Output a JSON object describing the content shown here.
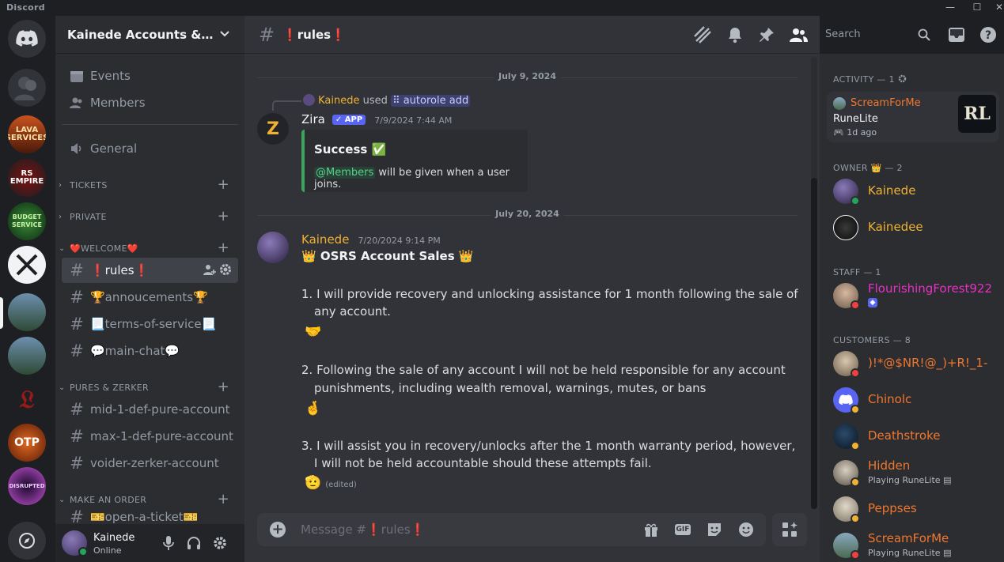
{
  "window": {
    "brand": "Discord",
    "controls": [
      "minimize",
      "maximize",
      "close"
    ]
  },
  "rail": {
    "servers": [
      {
        "label": "LAVA SERVICES",
        "color": "#c8521f"
      },
      {
        "label": "RS EMPIRE",
        "color": "#7a1010"
      },
      {
        "label": "BUDGET SERVICE",
        "color": "#1c5a22"
      },
      {
        "label": "",
        "color": "#f2f3f5"
      },
      {
        "label": "",
        "color": "#4a6a84"
      },
      {
        "label": "",
        "color": "#4a6a84"
      },
      {
        "label": "",
        "color": "#1e1f22"
      },
      {
        "label": "OTP",
        "color": "#b3461b"
      },
      {
        "label": "DISRUPTED",
        "color": "#5a1f7a"
      }
    ]
  },
  "guild": {
    "name": "Kainede Accounts & Ser...",
    "events_label": "Events",
    "members_label": "Members",
    "general_label": "General",
    "categories": {
      "tickets": "TICKETS",
      "private": "PRIVATE",
      "welcome": "❤️WELCOME❤️",
      "pures": "PURES & ZERKER",
      "order": "MAKE AN ORDER"
    },
    "welcome_channels": [
      "❗rules❗",
      "🏆annoucements🏆",
      "📃terms-of-service📃",
      "💬main-chat💬"
    ],
    "pures_channels": [
      "mid-1-def-pure-account",
      "max-1-def-pure-account",
      "voider-zerker-account"
    ],
    "order_channels": [
      "🎫open-a-ticket🎫"
    ]
  },
  "user": {
    "name": "Kainede",
    "status": "Online"
  },
  "chat": {
    "channel_name": "❗rules❗",
    "search_placeholder": "Search",
    "date1": "July 9, 2024",
    "date2": "July 20, 2024",
    "reply": {
      "user": "Kainede",
      "verb": "used",
      "command": "autorole add"
    },
    "msg1": {
      "author": "Zira",
      "tag": "✓ APP",
      "time": "7/9/2024 7:44 AM",
      "embed_title": "Success ✅",
      "embed_mention": "@Members",
      "embed_text": " will be given when a user joins."
    },
    "msg2": {
      "author": "Kainede",
      "time": "7/20/2024 9:14 PM",
      "title": "👑 OSRS Account Sales 👑",
      "item1_a": "1. I will provide recovery and unlocking assistance for 1 month following the sale of",
      "item1_b": "any account.",
      "emoji1": "🤝",
      "item2_a": "2. Following the sale of any account I will not be held responsible for any account",
      "item2_b": "punishments, including wealth removal, warnings, mutes, or bans",
      "emoji2": "🤞",
      "item3_a": "3. I will assist you in recovery/unlocks after the 1 month warranty period, however,",
      "item3_b": "I will not be held accountable should these attempts fail.",
      "emoji3": "🫡",
      "edited": "(edited)"
    },
    "composer_placeholder": "Message #❗rules❗"
  },
  "members": {
    "activity_header": "ACTIVITY — 1",
    "activity": {
      "name": "ScreamForMe",
      "game": "RuneLite",
      "time": "1d ago",
      "art": "RL"
    },
    "owner_header": "OWNER 👑 — 2",
    "owners": [
      {
        "name": "Kainede",
        "color": "#f0b232"
      },
      {
        "name": "Kainedee",
        "color": "#f0b232"
      }
    ],
    "staff_header": "STAFF — 1",
    "staff": [
      {
        "name": "FlourishingForest922",
        "color": "#e831c4"
      }
    ],
    "customers_header": "CUSTOMERS — 8",
    "customers": [
      {
        "name": ")!*@$NR!@_)+R!_1-",
        "color": "#f0772f",
        "sub": ""
      },
      {
        "name": "Chinolc",
        "color": "#f0772f",
        "sub": ""
      },
      {
        "name": "Deathstroke",
        "color": "#f0772f",
        "sub": ""
      },
      {
        "name": "Hidden",
        "color": "#f0772f",
        "sub": "Playing RuneLite"
      },
      {
        "name": "Peppses",
        "color": "#f0772f",
        "sub": ""
      },
      {
        "name": "ScreamForMe",
        "color": "#f0772f",
        "sub": "Playing RuneLite"
      }
    ]
  },
  "colors": {
    "accent": "#5865f2",
    "online": "#23a55a",
    "idle": "#f0b232",
    "dnd": "#f23f43"
  }
}
